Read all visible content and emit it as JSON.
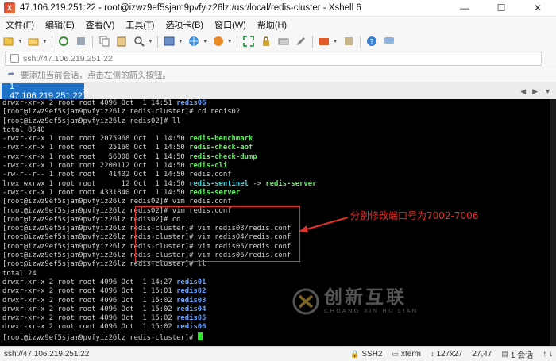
{
  "window": {
    "title": "47.106.219.251:22 - root@izwz9ef5sjam9pvfyiz26lz:/usr/local/redis-cluster - Xshell 6",
    "app_icon_label": "X"
  },
  "menu": {
    "items": [
      "文件(F)",
      "编辑(E)",
      "查看(V)",
      "工具(T)",
      "选项卡(B)",
      "窗口(W)",
      "帮助(H)"
    ]
  },
  "address": {
    "value": "ssh://47.106.219.251:22"
  },
  "hint": {
    "text": "要添加当前会话，点击左侧的箭头按钮。"
  },
  "tabs": [
    {
      "label": "1 47.106.219.251:22",
      "active": true
    }
  ],
  "terminal": {
    "lines": [
      [
        {
          "t": "drwxr-xr-x 2 root root 4096 Oct  1 14:51 "
        },
        {
          "t": "redis06",
          "c": "b"
        }
      ],
      [
        {
          "t": "[root@izwz9ef5sjam9pvfyiz26lz redis-cluster]# cd redis02"
        }
      ],
      [
        {
          "t": "[root@izwz9ef5sjam9pvfyiz26lz redis02]# ll"
        }
      ],
      [
        {
          "t": "total 8540"
        }
      ],
      [
        {
          "t": "-rwxr-xr-x 1 root root 2075968 Oct  1 14:50 "
        },
        {
          "t": "redis-benchmark",
          "c": "g"
        }
      ],
      [
        {
          "t": "-rwxr-xr-x 1 root root   25160 Oct  1 14:50 "
        },
        {
          "t": "redis-check-aof",
          "c": "g"
        }
      ],
      [
        {
          "t": "-rwxr-xr-x 1 root root   56008 Oct  1 14:50 "
        },
        {
          "t": "redis-check-dump",
          "c": "g"
        }
      ],
      [
        {
          "t": "-rwxr-xr-x 1 root root 2200112 Oct  1 14:50 "
        },
        {
          "t": "redis-cli",
          "c": "g"
        }
      ],
      [
        {
          "t": "-rw-r--r-- 1 root root   41402 Oct  1 14:50 redis.conf"
        }
      ],
      [
        {
          "t": "lrwxrwxrwx 1 root root      12 Oct  1 14:50 "
        },
        {
          "t": "redis-sentinel",
          "c": "c"
        },
        {
          "t": " -> "
        },
        {
          "t": "redis-server",
          "c": "g"
        }
      ],
      [
        {
          "t": "-rwxr-xr-x 1 root root 4331840 Oct  1 14:50 "
        },
        {
          "t": "redis-server",
          "c": "g"
        }
      ],
      [
        {
          "t": "[root@izwz9ef5sjam9pvfyiz26lz redis02]# vim redis.conf"
        }
      ],
      [
        {
          "t": "[root@izwz9ef5sjam9pvfyiz26lz redis02]# vim redis.conf"
        }
      ],
      [
        {
          "t": "[root@izwz9ef5sjam9pvfyiz26lz redis02]# cd .."
        }
      ],
      [
        {
          "t": "[root@izwz9ef5sjam9pvfyiz26lz redis-cluster]# vim redis03/redis.conf"
        }
      ],
      [
        {
          "t": "[root@izwz9ef5sjam9pvfyiz26lz redis-cluster]# vim redis04/redis.conf"
        }
      ],
      [
        {
          "t": "[root@izwz9ef5sjam9pvfyiz26lz redis-cluster]# vim redis05/redis.conf"
        }
      ],
      [
        {
          "t": "[root@izwz9ef5sjam9pvfyiz26lz redis-cluster]# vim redis06/redis.conf"
        }
      ],
      [
        {
          "t": "[root@izwz9ef5sjam9pvfyiz26lz redis-cluster]# ll"
        }
      ],
      [
        {
          "t": "total 24"
        }
      ],
      [
        {
          "t": "drwxr-xr-x 2 root root 4096 Oct  1 14:27 "
        },
        {
          "t": "redis01",
          "c": "b"
        }
      ],
      [
        {
          "t": "drwxr-xr-x 2 root root 4096 Oct  1 15:01 "
        },
        {
          "t": "redis02",
          "c": "b"
        }
      ],
      [
        {
          "t": "drwxr-xr-x 2 root root 4096 Oct  1 15:02 "
        },
        {
          "t": "redis03",
          "c": "b"
        }
      ],
      [
        {
          "t": "drwxr-xr-x 2 root root 4096 Oct  1 15:02 "
        },
        {
          "t": "redis04",
          "c": "b"
        }
      ],
      [
        {
          "t": "drwxr-xr-x 2 root root 4096 Oct  1 15:02 "
        },
        {
          "t": "redis05",
          "c": "b"
        }
      ],
      [
        {
          "t": "drwxr-xr-x 2 root root 4096 Oct  1 15:02 "
        },
        {
          "t": "redis06",
          "c": "b"
        }
      ],
      [
        {
          "t": "[root@izwz9ef5sjam9pvfyiz26lz redis-cluster]# "
        }
      ]
    ]
  },
  "annotation": {
    "text": "分别修改端口号为7002-7006",
    "color": "#e0312a"
  },
  "watermark": {
    "text_cn": "创新互联",
    "text_en": "CHUANG XIN HU LIAN"
  },
  "status": {
    "session": "ssh://47.106.219.251:22",
    "protocol": "SSH2",
    "terminal_type": "xterm",
    "size": "127x27",
    "position": "27,47",
    "sessions": "1 会话"
  }
}
